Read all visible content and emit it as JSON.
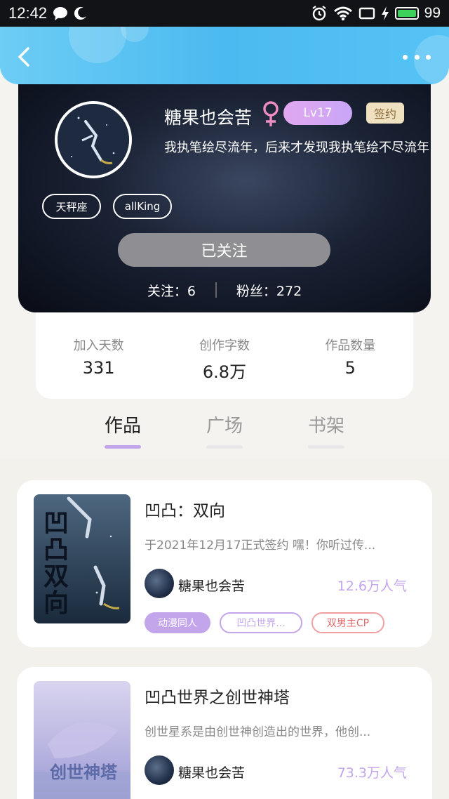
{
  "status_bar": {
    "time": "12:42",
    "battery_pct": "99",
    "icons": [
      "chat-bubble-icon",
      "moon-icon",
      "alarm-icon",
      "wifi-icon",
      "screen-icon",
      "charging-icon",
      "battery-icon"
    ],
    "battery_color": "#3bd15a"
  },
  "header": {
    "back_icon": "chevron-left-icon",
    "more_icon": "more-dots-icon",
    "gradient": [
      "#6dcdf5",
      "#4bbaf0"
    ]
  },
  "profile": {
    "username": "糖果也会苦",
    "gender_symbol": "♀",
    "gender_color": "#f08cc4",
    "level": "Lv17",
    "sign_badge": "签约",
    "signature": "我执笔绘尽流年，后来才发现我执笔绘不尽流年",
    "tags": [
      "天秤座",
      "allKing"
    ],
    "follow_button": "已关注",
    "following_label": "关注：6",
    "fans_label": "粉丝：272"
  },
  "stats": [
    {
      "label": "加入天数",
      "value": "331"
    },
    {
      "label": "创作字数",
      "value": "6.8万"
    },
    {
      "label": "作品数量",
      "value": "5"
    }
  ],
  "tabs": [
    {
      "label": "作品",
      "active": true
    },
    {
      "label": "广场",
      "active": false
    },
    {
      "label": "书架",
      "active": false
    }
  ],
  "accent_purple": "#c3a5ec",
  "works": [
    {
      "title": "凹凸：双向",
      "description": "于2021年12月17正式签约  嘿！你听过传...",
      "author": "糖果也会苦",
      "popularity": "12.6万人气",
      "cover_text": "凹凸双向",
      "tags": [
        {
          "label": "动漫同人",
          "style": "filled"
        },
        {
          "label": "凹凸世界...",
          "style": "outline-purple"
        },
        {
          "label": "双男主CP",
          "style": "outline-red"
        }
      ]
    },
    {
      "title": "凹凸世界之创世神塔",
      "description": "创世星系是由创世神创造出的世界，他创...",
      "author": "糖果也会苦",
      "popularity": "73.3万人气",
      "cover_text": "创世神塔",
      "tags": []
    }
  ]
}
